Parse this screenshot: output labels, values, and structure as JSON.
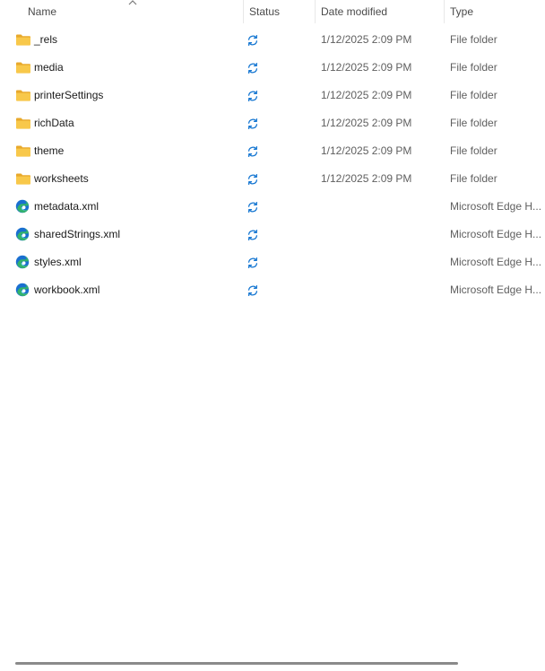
{
  "columns": {
    "name": "Name",
    "status": "Status",
    "date_modified": "Date modified",
    "type": "Type"
  },
  "sort": {
    "column": "name",
    "direction": "ascending",
    "icon": "chevron-up-icon"
  },
  "status_icon": "sync-pending-icon",
  "colors": {
    "folder": "#f5c542",
    "sync": "#1677d2",
    "edge_blue": "#1a6fd1",
    "edge_green": "#33b36b"
  },
  "files": [
    {
      "name": "_rels",
      "date": "1/12/2025 2:09 PM",
      "type": "File folder",
      "icon": "folder-icon"
    },
    {
      "name": "media",
      "date": "1/12/2025 2:09 PM",
      "type": "File folder",
      "icon": "folder-icon"
    },
    {
      "name": "printerSettings",
      "date": "1/12/2025 2:09 PM",
      "type": "File folder",
      "icon": "folder-icon"
    },
    {
      "name": "richData",
      "date": "1/12/2025 2:09 PM",
      "type": "File folder",
      "icon": "folder-icon"
    },
    {
      "name": "theme",
      "date": "1/12/2025 2:09 PM",
      "type": "File folder",
      "icon": "folder-icon"
    },
    {
      "name": "worksheets",
      "date": "1/12/2025 2:09 PM",
      "type": "File folder",
      "icon": "folder-icon"
    },
    {
      "name": "metadata.xml",
      "date": "",
      "type": "Microsoft Edge H...",
      "icon": "edge-icon"
    },
    {
      "name": "sharedStrings.xml",
      "date": "",
      "type": "Microsoft Edge H...",
      "icon": "edge-icon"
    },
    {
      "name": "styles.xml",
      "date": "",
      "type": "Microsoft Edge H...",
      "icon": "edge-icon"
    },
    {
      "name": "workbook.xml",
      "date": "",
      "type": "Microsoft Edge H...",
      "icon": "edge-icon"
    }
  ]
}
